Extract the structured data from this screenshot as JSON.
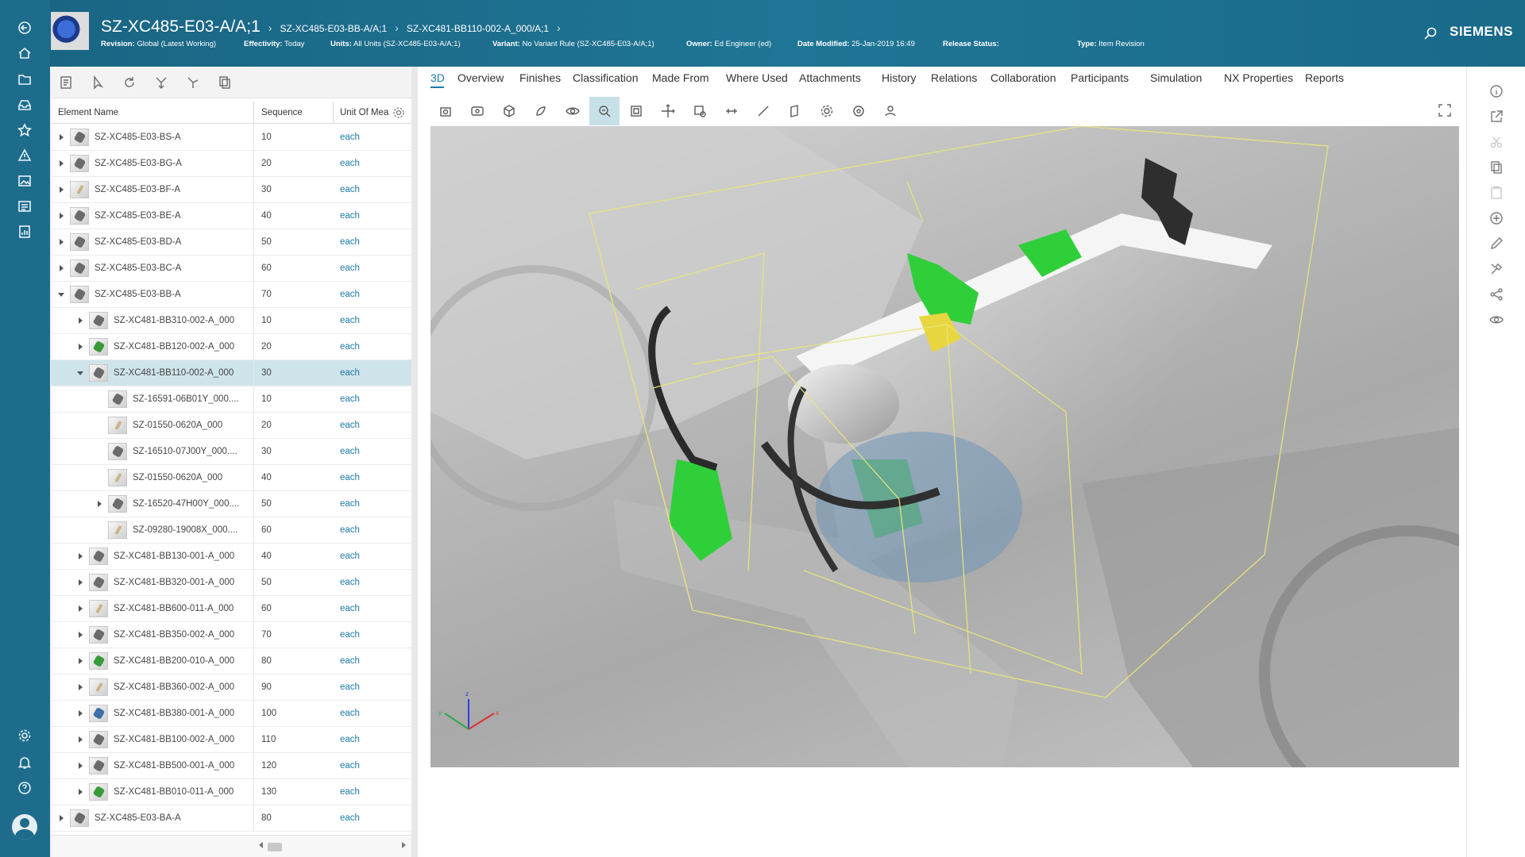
{
  "header": {
    "title": "SZ-XC485-E03-A/A;1",
    "breadcrumbs": [
      "SZ-XC485-E03-BB-A/A;1",
      "SZ-XC481-BB110-002-A_000/A;1"
    ],
    "meta": {
      "revision_label": "Revision:",
      "revision_value": "Global (Latest Working)",
      "effectivity_label": "Effectivity:",
      "effectivity_value": "Today",
      "units_label": "Units:",
      "units_value": "All Units (SZ-XC485-E03-A/A;1)",
      "variant_label": "Variant:",
      "variant_value": "No Variant Rule (SZ-XC485-E03-A/A;1)",
      "owner_label": "Owner:",
      "owner_value": "Ed Engineer (ed)",
      "modified_label": "Date Modified:",
      "modified_value": "25-Jan-2019 16:49",
      "release_label": "Release Status:",
      "release_value": "",
      "type_label": "Type:",
      "type_value": "Item Revision"
    },
    "brand": "SIEMENS"
  },
  "left_rail_icons": [
    "back-icon",
    "home-icon",
    "folder-icon",
    "inbox-icon",
    "favorites-icon",
    "alert-icon",
    "gallery-icon",
    "news-icon",
    "report-icon",
    "settings-icon",
    "bell-icon",
    "help-icon"
  ],
  "tree": {
    "columns": [
      "Element Name",
      "Sequence",
      "Unit Of Measure"
    ],
    "rows": [
      {
        "level": 0,
        "expand": "collapsed",
        "name": "SZ-XC485-E03-BS-A",
        "seq": "10",
        "uom": "each",
        "icon": "grey"
      },
      {
        "level": 0,
        "expand": "collapsed",
        "name": "SZ-XC485-E03-BG-A",
        "seq": "20",
        "uom": "each",
        "icon": "grey"
      },
      {
        "level": 0,
        "expand": "collapsed",
        "name": "SZ-XC485-E03-BF-A",
        "seq": "30",
        "uom": "each",
        "icon": "pale"
      },
      {
        "level": 0,
        "expand": "collapsed",
        "name": "SZ-XC485-E03-BE-A",
        "seq": "40",
        "uom": "each",
        "icon": "grey"
      },
      {
        "level": 0,
        "expand": "collapsed",
        "name": "SZ-XC485-E03-BD-A",
        "seq": "50",
        "uom": "each",
        "icon": "grey"
      },
      {
        "level": 0,
        "expand": "collapsed",
        "name": "SZ-XC485-E03-BC-A",
        "seq": "60",
        "uom": "each",
        "icon": "grey"
      },
      {
        "level": 0,
        "expand": "expanded",
        "name": "SZ-XC485-E03-BB-A",
        "seq": "70",
        "uom": "each",
        "icon": "grey"
      },
      {
        "level": 1,
        "expand": "collapsed",
        "name": "SZ-XC481-BB310-002-A_000",
        "seq": "10",
        "uom": "each",
        "icon": "grey"
      },
      {
        "level": 1,
        "expand": "collapsed",
        "name": "SZ-XC481-BB120-002-A_000",
        "seq": "20",
        "uom": "each",
        "icon": "green"
      },
      {
        "level": 1,
        "expand": "expanded",
        "name": "SZ-XC481-BB110-002-A_000",
        "seq": "30",
        "uom": "each",
        "icon": "grey",
        "selected": true
      },
      {
        "level": 2,
        "expand": "none",
        "name": "SZ-16591-06B01Y_000....",
        "seq": "10",
        "uom": "each",
        "icon": "grey"
      },
      {
        "level": 2,
        "expand": "none",
        "name": "SZ-01550-0620A_000",
        "seq": "20",
        "uom": "each",
        "icon": "pale"
      },
      {
        "level": 2,
        "expand": "none",
        "name": "SZ-16510-07J00Y_000....",
        "seq": "30",
        "uom": "each",
        "icon": "grey"
      },
      {
        "level": 2,
        "expand": "none",
        "name": "SZ-01550-0620A_000",
        "seq": "40",
        "uom": "each",
        "icon": "pale"
      },
      {
        "level": 2,
        "expand": "collapsed",
        "name": "SZ-16520-47H00Y_000....",
        "seq": "50",
        "uom": "each",
        "icon": "grey"
      },
      {
        "level": 2,
        "expand": "none",
        "name": "SZ-09280-19008X_000....",
        "seq": "60",
        "uom": "each",
        "icon": "pale"
      },
      {
        "level": 1,
        "expand": "collapsed",
        "name": "SZ-XC481-BB130-001-A_000",
        "seq": "40",
        "uom": "each",
        "icon": "grey"
      },
      {
        "level": 1,
        "expand": "collapsed",
        "name": "SZ-XC481-BB320-001-A_000",
        "seq": "50",
        "uom": "each",
        "icon": "grey"
      },
      {
        "level": 1,
        "expand": "collapsed",
        "name": "SZ-XC481-BB600-011-A_000",
        "seq": "60",
        "uom": "each",
        "icon": "pale"
      },
      {
        "level": 1,
        "expand": "collapsed",
        "name": "SZ-XC481-BB350-002-A_000",
        "seq": "70",
        "uom": "each",
        "icon": "grey"
      },
      {
        "level": 1,
        "expand": "collapsed",
        "name": "SZ-XC481-BB200-010-A_000",
        "seq": "80",
        "uom": "each",
        "icon": "green"
      },
      {
        "level": 1,
        "expand": "collapsed",
        "name": "SZ-XC481-BB360-002-A_000",
        "seq": "90",
        "uom": "each",
        "icon": "pale"
      },
      {
        "level": 1,
        "expand": "collapsed",
        "name": "SZ-XC481-BB380-001-A_000",
        "seq": "100",
        "uom": "each",
        "icon": "blue"
      },
      {
        "level": 1,
        "expand": "collapsed",
        "name": "SZ-XC481-BB100-002-A_000",
        "seq": "110",
        "uom": "each",
        "icon": "grey"
      },
      {
        "level": 1,
        "expand": "collapsed",
        "name": "SZ-XC481-BB500-001-A_000",
        "seq": "120",
        "uom": "each",
        "icon": "grey"
      },
      {
        "level": 1,
        "expand": "collapsed",
        "name": "SZ-XC481-BB010-011-A_000",
        "seq": "130",
        "uom": "each",
        "icon": "green"
      },
      {
        "level": 0,
        "expand": "collapsed",
        "name": "SZ-XC485-E03-BA-A",
        "seq": "80",
        "uom": "each",
        "icon": "grey"
      }
    ]
  },
  "tabs": [
    "3D",
    "Overview",
    "Finishes",
    "Classification",
    "Made From",
    "Where Used",
    "Attachments",
    "History",
    "Relations",
    "Collaboration",
    "Participants",
    "Simulation",
    "NX Properties",
    "Reports"
  ],
  "active_tab": "3D",
  "viewer": {
    "axis_labels": {
      "x": "x",
      "y": "y",
      "z": "z"
    },
    "tool_icons": [
      "snapshot-icon",
      "capture-icon",
      "view-orientation-icon",
      "shading-icon",
      "visibility-icon",
      "selection-icon",
      "fit-all-icon",
      "move-icon",
      "section-icon",
      "measure-icon",
      "markup-icon",
      "3d-part-icon",
      "settings-icon",
      "target-icon",
      "people-icon"
    ]
  },
  "right_rail_icons": [
    "info-icon",
    "open-icon",
    "cut-icon",
    "copy-icon",
    "paste-icon",
    "add-icon",
    "edit-icon",
    "tools-icon",
    "share-icon",
    "watch-icon"
  ],
  "colors": {
    "header": "#1e6c8c",
    "accent": "#1c7aa8",
    "selection": "#cfe4ea",
    "highlight_green": "#2fcf3a",
    "bbox_yellow": "#e8e57a"
  }
}
